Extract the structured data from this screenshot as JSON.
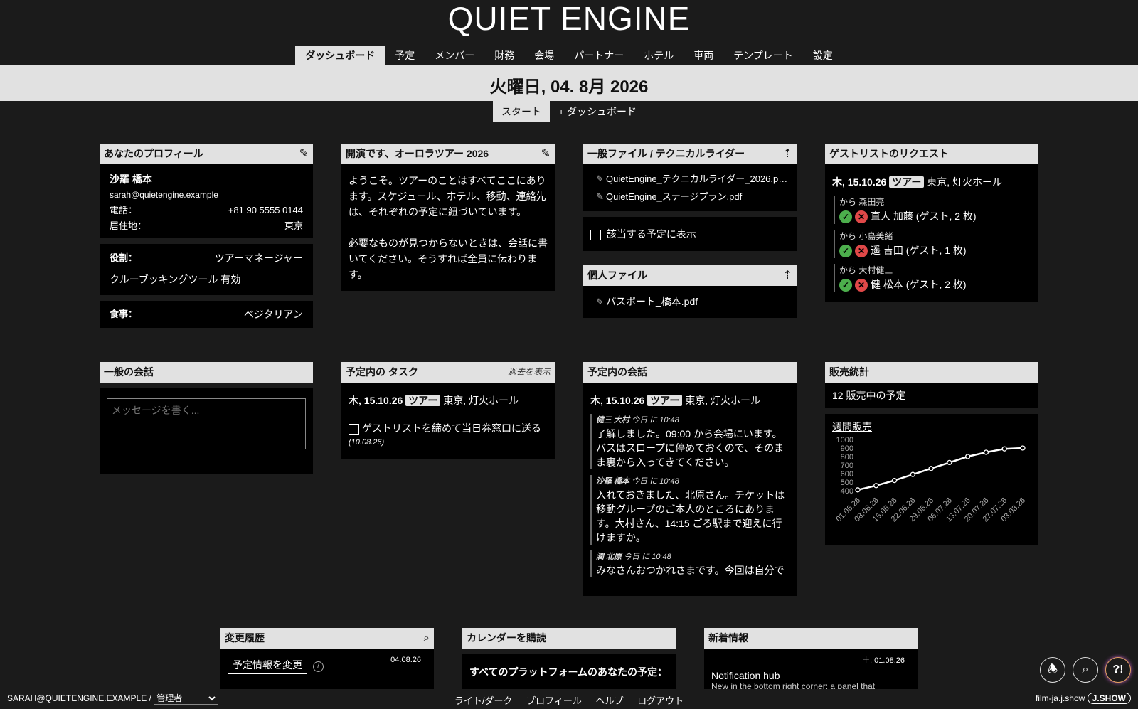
{
  "app": {
    "title": "QUIET ENGINE"
  },
  "nav": [
    {
      "label": "ダッシュボード",
      "active": true
    },
    {
      "label": "予定"
    },
    {
      "label": "メンバー"
    },
    {
      "label": "財務"
    },
    {
      "label": "会場"
    },
    {
      "label": "パートナー"
    },
    {
      "label": "ホテル"
    },
    {
      "label": "車両"
    },
    {
      "label": "テンプレート"
    },
    {
      "label": "設定"
    }
  ],
  "date": "火曜日, 04. 8月 2026",
  "subtabs": {
    "start": "スタート",
    "add": "+ ダッシュボード"
  },
  "profile": {
    "title": "あなたのプロフィール",
    "name": "沙羅 橋本",
    "email": "sarah@quietengine.example",
    "phone_label": "電話：",
    "phone": "+81 90 5555 0144",
    "residence_label": "居住地：",
    "residence": "東京",
    "role_label": "役割：",
    "role": "ツアーマネージャー",
    "crew_booking": "クルーブッキングツール 有効",
    "diet_label": "食事：",
    "diet": "ベジタリアン"
  },
  "welcome": {
    "title": "開演です、オーロラツアー 2026",
    "p1": "ようこそ。ツアーのことはすべてここにあります。スケジュール、ホテル、移動、連絡先は、それぞれの予定に紐づいています。",
    "p2": "必要なものが見つからないときは、会話に書いてください。そうすれば全員に伝わります。"
  },
  "files": {
    "title": "一般ファイル / テクニカルライダー",
    "items": [
      "QuietEngine_テクニカルライダー_2026.p…",
      "QuietEngine_ステージプラン.pdf"
    ],
    "show_in_event": "該当する予定に表示",
    "personal_title": "個人ファイル",
    "personal_items": [
      "パスポート_橋本.pdf"
    ]
  },
  "guestlist": {
    "title": "ゲストリストのリクエスト",
    "event": {
      "date": "木, 15.10.26",
      "badge": "ツアー",
      "place": "東京, 灯火ホール"
    },
    "requests": [
      {
        "from": "から 森田亮",
        "who": "直人 加藤 (ゲスト, 2 枚)"
      },
      {
        "from": "から 小島美緒",
        "who": "遥 吉田 (ゲスト, 1 枚)"
      },
      {
        "from": "から 大村健三",
        "who": "健 松本 (ゲスト, 2 枚)"
      }
    ]
  },
  "general_chat": {
    "title": "一般の会話",
    "placeholder": "メッセージを書く..."
  },
  "tasks": {
    "title": "予定内の タスク",
    "show_past": "過去を表示",
    "event": {
      "date": "木, 15.10.26",
      "badge": "ツアー",
      "place": "東京, 灯火ホール"
    },
    "task": "ゲストリストを締めて当日券窓口に送る",
    "due": "(10.08.26)"
  },
  "event_chat": {
    "title": "予定内の会話",
    "event": {
      "date": "木, 15.10.26",
      "badge": "ツアー",
      "place": "東京, 灯火ホール"
    },
    "messages": [
      {
        "author": "健三 大村",
        "time": "今日 に 10:48",
        "text": "了解しました。09:00 から会場にいます。バスはスロープに停めておくので、そのまま裏から入ってきてください。"
      },
      {
        "author": "沙羅 橋本",
        "time": "今日 に 10:48",
        "text": "入れておきました、北原さん。チケットは移動グループのご本人のところにあります。大村さん、14:15 ごろ駅まで迎えに行けますか。"
      },
      {
        "author": "潤 北原",
        "time": "今日 に 10:48",
        "text": "みなさんおつかれさまです。今回は自分で"
      }
    ]
  },
  "sales": {
    "title": "販売統計",
    "summary": "12 販売中の予定",
    "weekly_link": "週間販売"
  },
  "chart_data": {
    "type": "line",
    "title": "週間販売",
    "categories": [
      "01.06.26",
      "08.06.26",
      "15.06.26",
      "22.06.26",
      "29.06.26",
      "06.07.26",
      "13.07.26",
      "20.07.26",
      "27.07.26",
      "03.08.26"
    ],
    "series": [
      {
        "values": [
          410,
          460,
          520,
          590,
          660,
          730,
          800,
          850,
          890,
          900
        ]
      }
    ],
    "yticks": [
      400,
      500,
      600,
      700,
      800,
      900,
      1000
    ],
    "ylim": [
      400,
      1000
    ]
  },
  "history": {
    "title": "変更履歴",
    "button": "予定情報を変更",
    "date": "04.08.26"
  },
  "calendar": {
    "title": "カレンダーを購読",
    "text": "すべてのプラットフォームのあなたの予定："
  },
  "news": {
    "title": "新着情報",
    "date": "土, 01.08.26",
    "headline": "Notification hub",
    "text": "New in the bottom right corner: a panel that"
  },
  "footer": {
    "user": "SARAH@QUIETENGINE.EXAMPLE /",
    "role": "管理者",
    "links": [
      "ライト/ダーク",
      "プロフィール",
      "ヘルプ",
      "ログアウト"
    ],
    "site": "film-ja.j.show",
    "logo": "J.SHOW"
  },
  "fabs": {
    "help": "?!"
  }
}
